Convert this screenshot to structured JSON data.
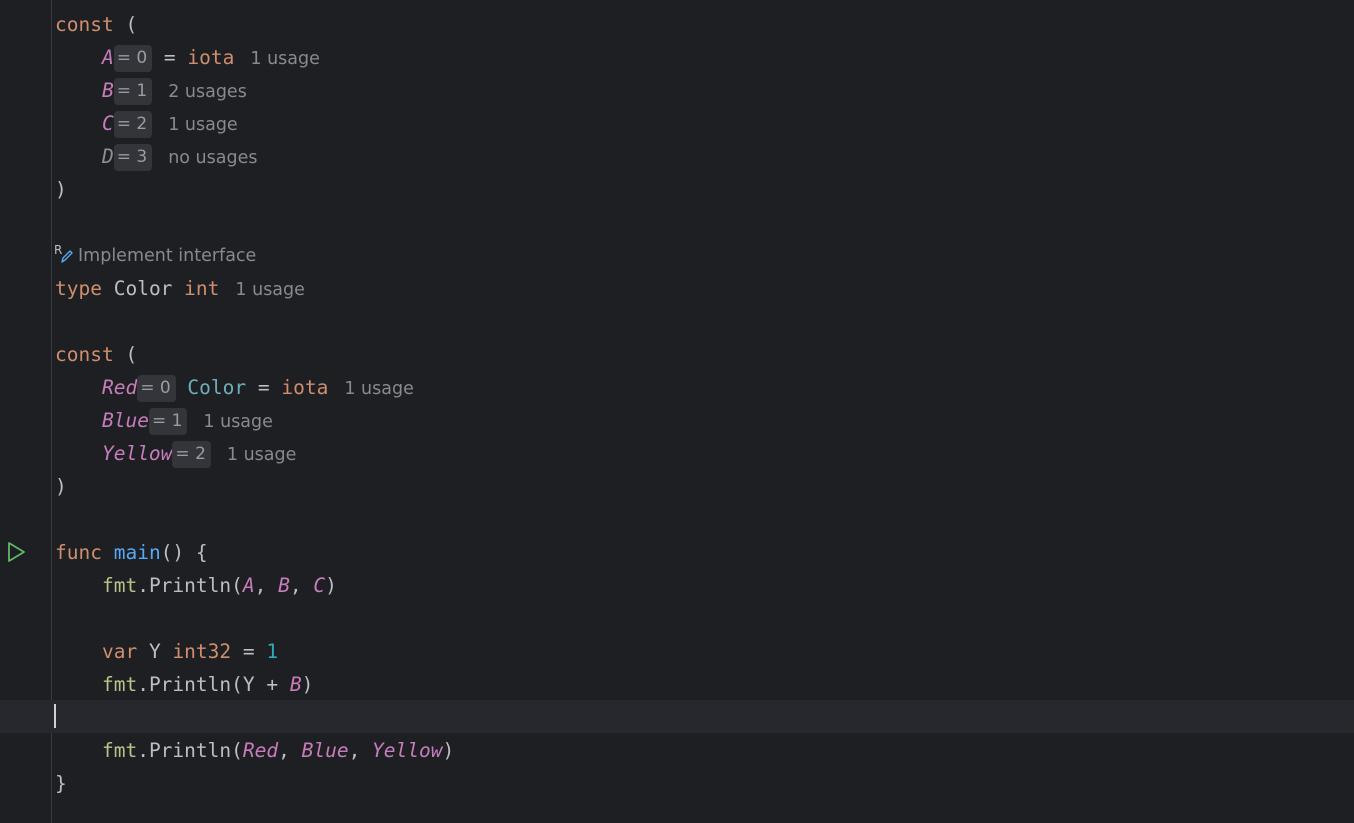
{
  "editor": {
    "lines": {
      "l1": {
        "kw": "const",
        "rest": " ("
      },
      "l2": {
        "name": "A",
        "hint": "= 0",
        "rest": " = ",
        "iota": "iota",
        "usage": "1 usage"
      },
      "l3": {
        "name": "B",
        "hint": "= 1",
        "usage": "2 usages"
      },
      "l4": {
        "name": "C",
        "hint": "= 2",
        "usage": "1 usage"
      },
      "l5": {
        "name": "D",
        "hint": "= 3",
        "usage": "no usages"
      },
      "l6": {
        "text": ")"
      },
      "lens": {
        "label": "Implement interface"
      },
      "l8": {
        "kw": "type",
        "name": "Color",
        "kw2": "int",
        "usage": "1 usage"
      },
      "l10": {
        "kw": "const",
        "rest": " ("
      },
      "l11": {
        "name": "Red",
        "hint": "= 0",
        "type": "Color",
        "rest": " = ",
        "iota": "iota",
        "usage": "1 usage"
      },
      "l12": {
        "name": "Blue",
        "hint": "= 1",
        "usage": "1 usage"
      },
      "l13": {
        "name": "Yellow",
        "hint": "= 2",
        "usage": "1 usage"
      },
      "l14": {
        "text": ")"
      },
      "l16": {
        "kw": "func",
        "fn": "main",
        "rest": "() {"
      },
      "l17": {
        "pkg": "fmt",
        "call": ".Println(",
        "a": "A",
        "sep1": ", ",
        "b": "B",
        "sep2": ", ",
        "c": "C",
        "close": ")"
      },
      "l19": {
        "kw": "var",
        "name": " Y ",
        "type": "int32",
        "rest": " = ",
        "num": "1"
      },
      "l20": {
        "pkg": "fmt",
        "call": ".Println(",
        "y": "Y + ",
        "b": "B",
        "close": ")"
      },
      "l22": {
        "pkg": "fmt",
        "call": ".Println(",
        "a": "Red",
        "sep1": ", ",
        "b": "Blue",
        "sep2": ", ",
        "c": "Yellow",
        "close": ")"
      },
      "l23": {
        "text": "}"
      }
    }
  },
  "colors": {
    "background": "#1e1f22",
    "keyword": "#cf8e6d",
    "constant": "#c77dbb",
    "function": "#56a8f5",
    "package": "#b9c28a",
    "number": "#2aacb8",
    "run_icon": "#5fb865"
  },
  "icons": {
    "run": "run-gutter-icon",
    "implement": "implement-interface-icon"
  }
}
